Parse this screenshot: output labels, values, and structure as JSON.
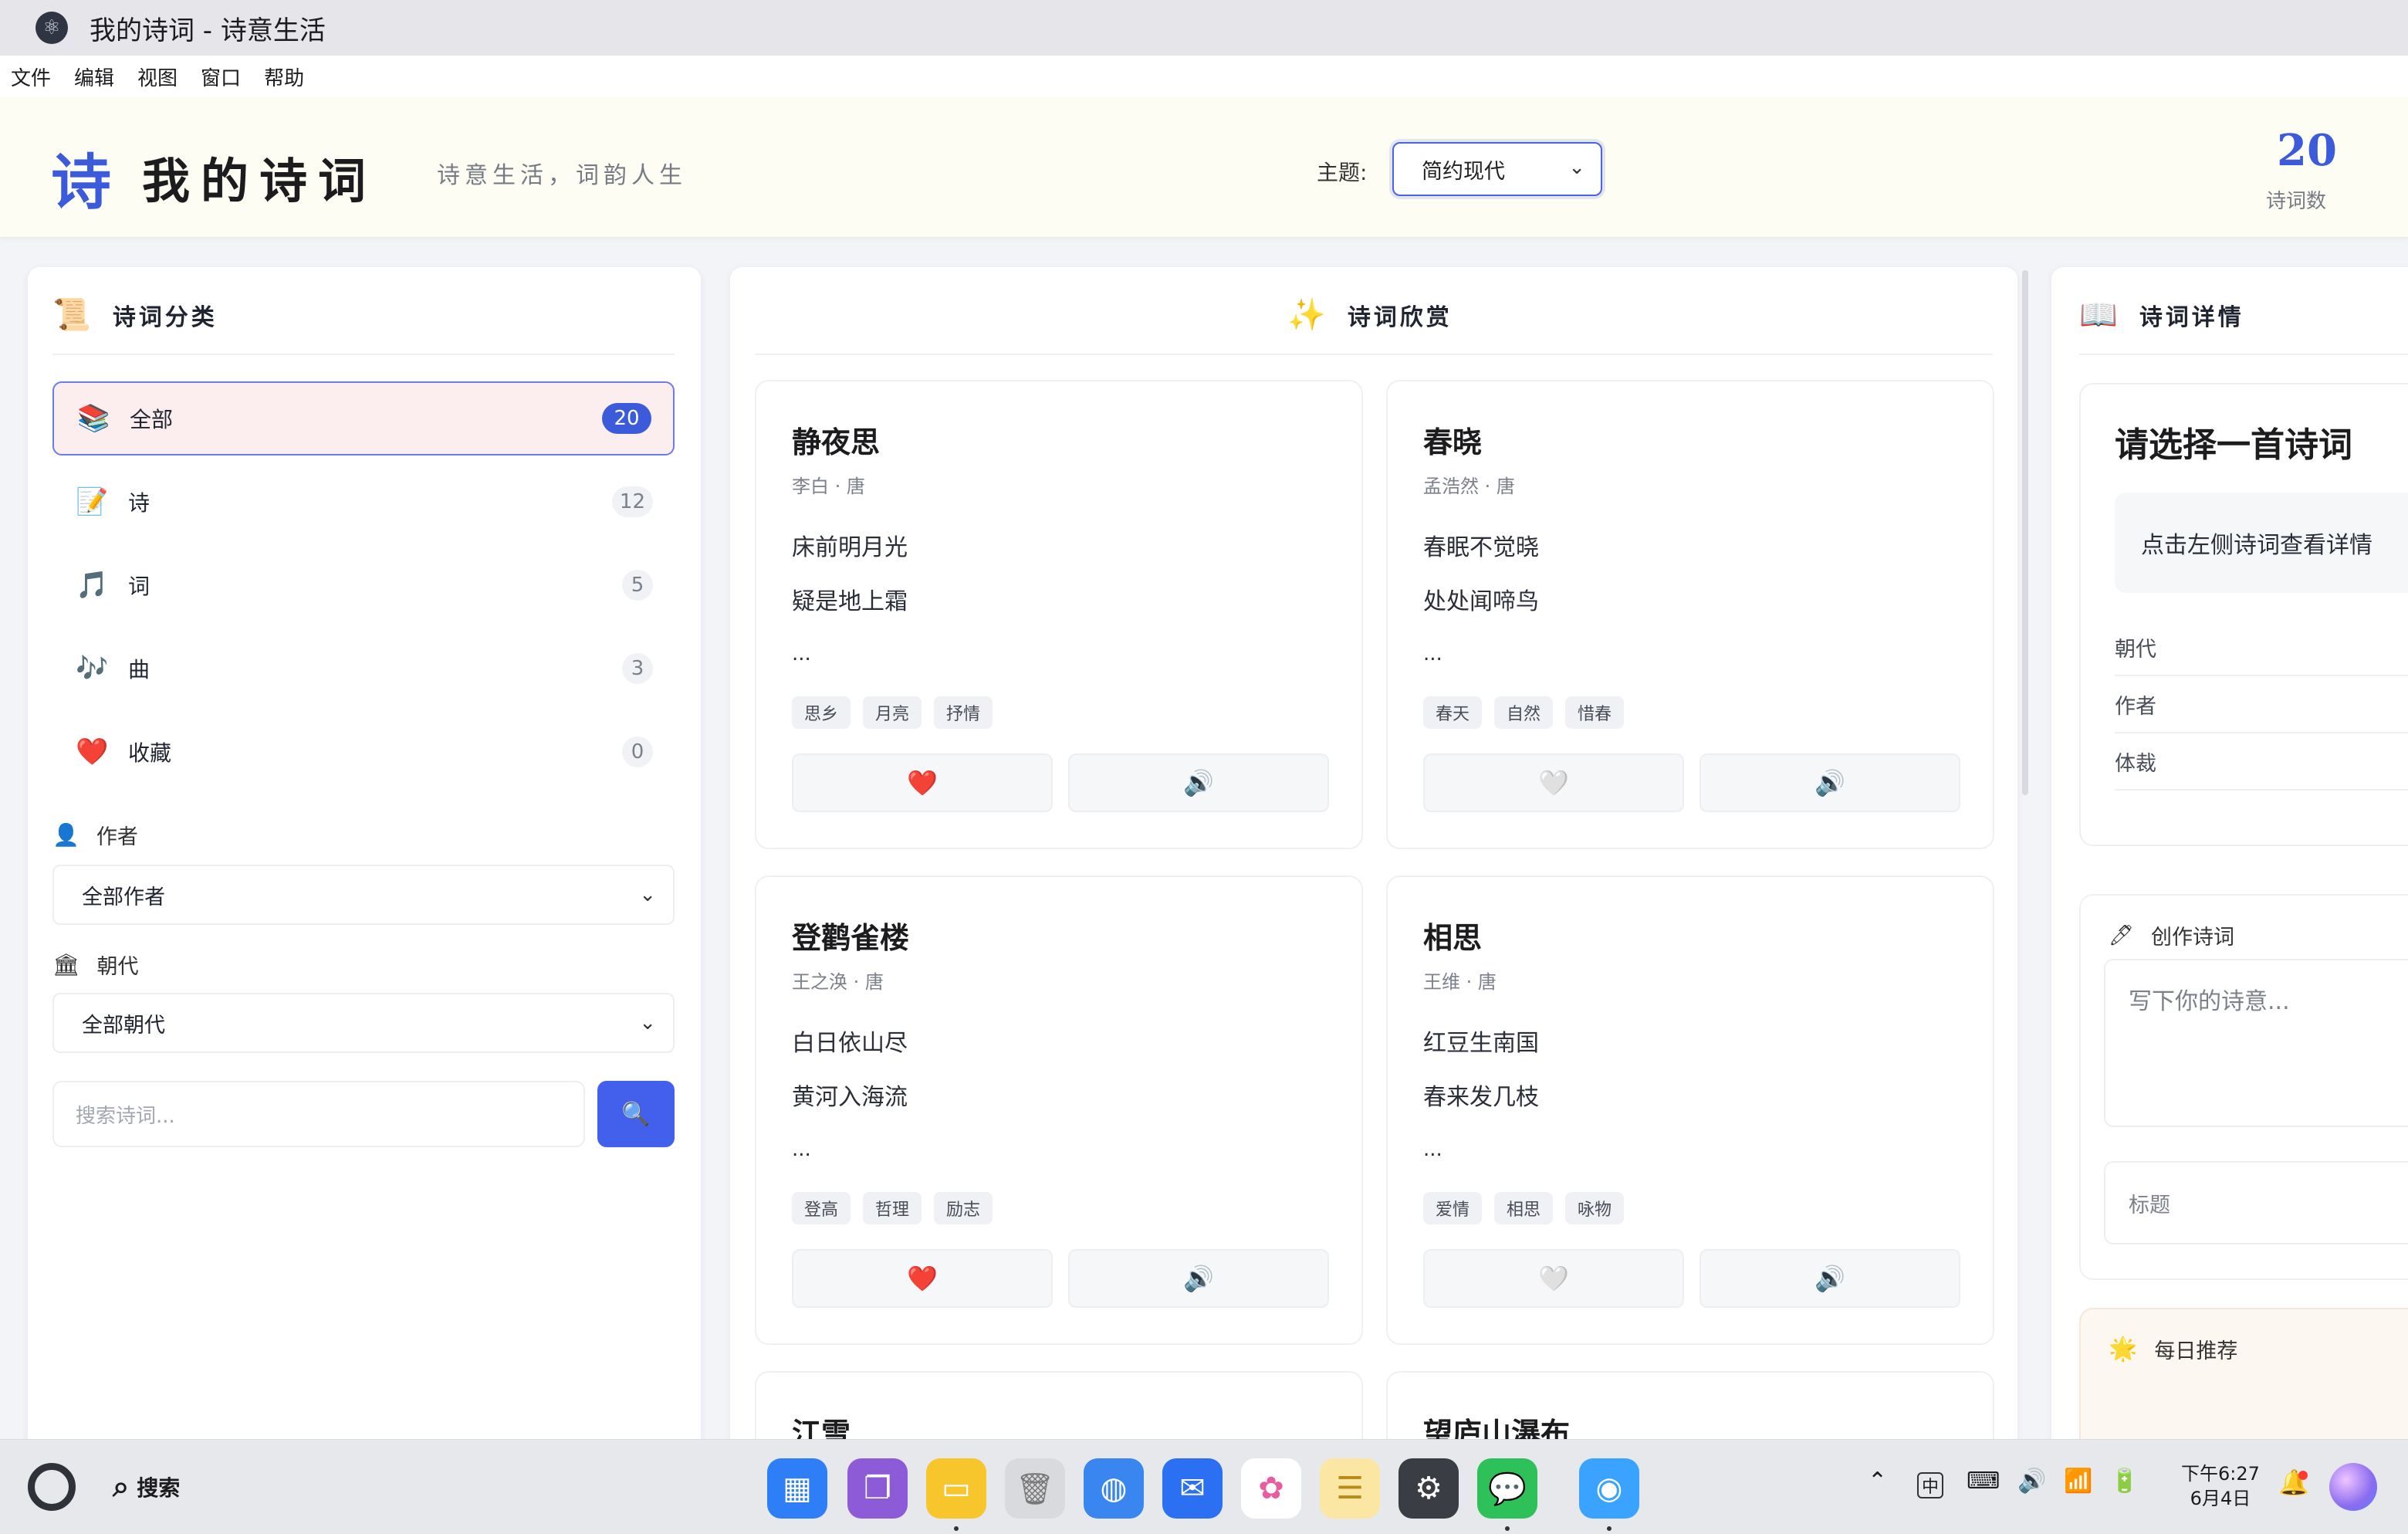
{
  "window": {
    "title": "我的诗词 - 诗意生活"
  },
  "menu": [
    "文件",
    "编辑",
    "视图",
    "窗口",
    "帮助"
  ],
  "header": {
    "logo_char": "诗",
    "app_name": "我的诗词",
    "slogan": "诗意生活，词韵人生",
    "theme_label": "主题:",
    "theme_value": "简约现代",
    "stat_count": "20",
    "stat_label": "诗词数"
  },
  "sidebar": {
    "title": "诗词分类",
    "title_icon": "scroll-icon",
    "categories": [
      {
        "icon": "books-icon",
        "label": "全部",
        "count": "20",
        "active": true
      },
      {
        "icon": "memo-icon",
        "label": "诗",
        "count": "12",
        "active": false
      },
      {
        "icon": "music-note-icon",
        "label": "词",
        "count": "5",
        "active": false
      },
      {
        "icon": "music-notes-icon",
        "label": "曲",
        "count": "3",
        "active": false
      },
      {
        "icon": "heart-icon",
        "label": "收藏",
        "count": "0",
        "active": false
      }
    ],
    "author_label": "作者",
    "author_value": "全部作者",
    "dynasty_label": "朝代",
    "dynasty_value": "全部朝代",
    "search_placeholder": "搜索诗词..."
  },
  "main": {
    "title": "诗词欣赏",
    "title_icon": "sparkles-icon",
    "poems": [
      {
        "title": "静夜思",
        "author": "李白 · 唐",
        "lines": [
          "床前明月光",
          "疑是地上霜"
        ],
        "ellipsis": "...",
        "tags": [
          "思乡",
          "月亮",
          "抒情"
        ],
        "favorited": true
      },
      {
        "title": "春晓",
        "author": "孟浩然 · 唐",
        "lines": [
          "春眠不觉晓",
          "处处闻啼鸟"
        ],
        "ellipsis": "...",
        "tags": [
          "春天",
          "自然",
          "惜春"
        ],
        "favorited": false
      },
      {
        "title": "登鹳雀楼",
        "author": "王之涣 · 唐",
        "lines": [
          "白日依山尽",
          "黄河入海流"
        ],
        "ellipsis": "...",
        "tags": [
          "登高",
          "哲理",
          "励志"
        ],
        "favorited": true
      },
      {
        "title": "相思",
        "author": "王维 · 唐",
        "lines": [
          "红豆生南国",
          "春来发几枝"
        ],
        "ellipsis": "...",
        "tags": [
          "爱情",
          "相思",
          "咏物"
        ],
        "favorited": false
      },
      {
        "title": "江雪"
      },
      {
        "title": "望庐山瀑布"
      }
    ]
  },
  "detail": {
    "title": "诗词详情",
    "title_icon": "open-book-icon",
    "heading": "请选择一首诗词",
    "hint": "点击左侧诗词查看详情",
    "meta": [
      "朝代",
      "作者",
      "体裁"
    ],
    "compose_title": "创作诗词",
    "compose_placeholder": "写下你的诗意...",
    "compose_title_placeholder": "标题",
    "daily_title": "每日推荐"
  },
  "taskbar": {
    "search_label": "搜索",
    "apps": [
      "launcher-icon",
      "multitask-icon",
      "files-icon",
      "trash-icon",
      "browser-icon",
      "mail-icon",
      "photos-icon",
      "notes-icon",
      "settings-icon",
      "wechat-icon",
      "finder-icon"
    ],
    "ime": "中",
    "time": "下午6:27",
    "date": "6月4日"
  },
  "colors": {
    "accent": "#3b5bdb",
    "active_bg": "#fceeee",
    "heart": "#e5232f",
    "header_bg": "#fdfdf3"
  }
}
